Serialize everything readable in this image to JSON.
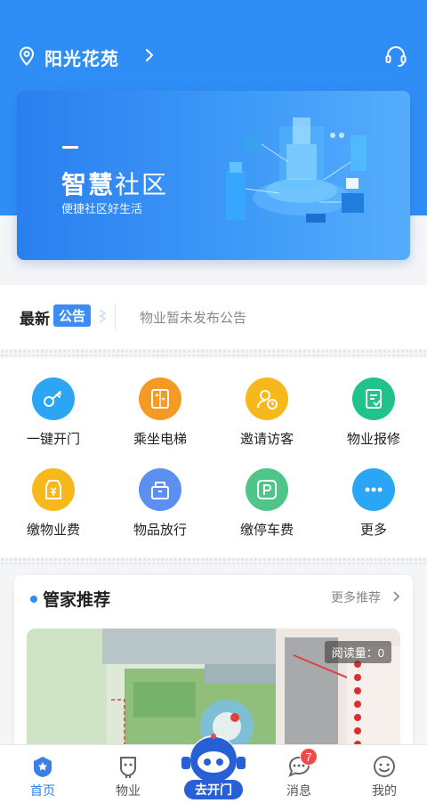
{
  "header": {
    "community_name": "阳光花苑",
    "location_icon": "location-pin-icon",
    "chevron_icon": "chevron-right-icon",
    "service_icon": "customer-service-headset-icon"
  },
  "banner": {
    "title_bold": "智慧",
    "title_light": "社区",
    "subtitle": "便捷社区好生活"
  },
  "notice": {
    "label_new": "最新",
    "label_badge": "公告",
    "text": "物业暂未发布公告"
  },
  "services": [
    {
      "label": "一键开门",
      "icon": "key-icon",
      "color": "#2aa6f4"
    },
    {
      "label": "乘坐电梯",
      "icon": "elevator-icon",
      "color": "#f59a23"
    },
    {
      "label": "邀请访客",
      "icon": "visitor-icon",
      "color": "#f6b81b"
    },
    {
      "label": "物业报修",
      "icon": "repair-icon",
      "color": "#22c38a"
    },
    {
      "label": "缴物业费",
      "icon": "property-fee-icon",
      "color": "#f6b81b"
    },
    {
      "label": "物品放行",
      "icon": "item-release-icon",
      "color": "#5b8ff0"
    },
    {
      "label": "缴停车费",
      "icon": "parking-fee-icon",
      "color": "#4fc58a"
    },
    {
      "label": "更多",
      "icon": "more-icon",
      "color": "#2aa6f4"
    }
  ],
  "recommend": {
    "title": "管家推荐",
    "more_label": "更多推荐",
    "read_count": "阅读量：0"
  },
  "tabbar": {
    "tabs": [
      {
        "label": "首页",
        "icon": "home-icon"
      },
      {
        "label": "物业",
        "icon": "property-icon"
      },
      {
        "label": "去开门",
        "icon": "open-door-robot-icon"
      },
      {
        "label": "消息",
        "icon": "message-icon"
      },
      {
        "label": "我的",
        "icon": "profile-icon"
      }
    ],
    "message_count": "7"
  },
  "colors": {
    "primary": "#2f8ef6",
    "accent": "#2760d4",
    "badge_red": "#f04a4a"
  }
}
